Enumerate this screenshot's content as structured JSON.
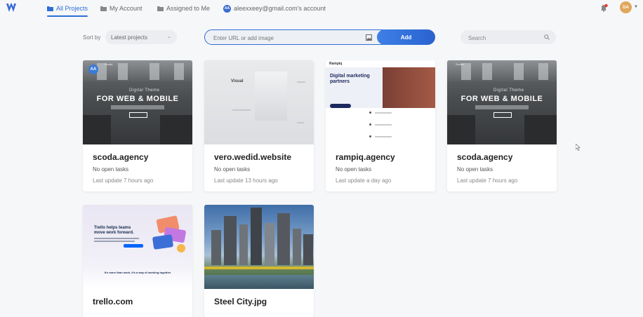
{
  "nav": {
    "tabs": [
      {
        "label": "All Projects",
        "icon": "folder-icon",
        "active": true
      },
      {
        "label": "My Account",
        "icon": "folder-icon",
        "active": false
      },
      {
        "label": "Assigned to Me",
        "icon": "folder-icon",
        "active": false
      },
      {
        "label": "aleexxeey@gmail.com's account",
        "icon": "account-badge",
        "badge": "AA",
        "active": false
      }
    ],
    "avatar_initials": "DA",
    "accent_color": "#2f6fd6"
  },
  "toolbar": {
    "sort_label": "Sort by",
    "sort_value": "Latest projects",
    "url_placeholder": "Enter URL or add image",
    "add_label": "Add",
    "search_placeholder": "Search"
  },
  "projects": [
    {
      "name": "scoda.agency",
      "tasks": "No open tasks",
      "updated": "Last update 7 hours ago",
      "thumb": {
        "badge": "AA",
        "brand": "Scoda",
        "small": "Digital Theme",
        "big": "FOR WEB & MOBILE"
      }
    },
    {
      "name": "vero.wedid.website",
      "tasks": "No open tasks",
      "updated": "Last update 13 hours ago",
      "thumb": {
        "label": "Visual"
      }
    },
    {
      "name": "rampiq.agency",
      "tasks": "No open tasks",
      "updated": "Last update a day ago",
      "thumb": {
        "logo": "Rampiq",
        "headline": "Digital marketing partners"
      }
    },
    {
      "name": "scoda.agency",
      "tasks": "No open tasks",
      "updated": "Last update 7 hours ago",
      "thumb": {
        "brand": "Scoda",
        "small": "Digital Theme",
        "big": "FOR WEB & MOBILE"
      }
    },
    {
      "name": "trello.com",
      "tasks": "",
      "updated": "",
      "thumb": {
        "headline": "Trello helps teams move work forward.",
        "middle": "It's more than work, it's a way of working together"
      }
    },
    {
      "name": "Steel City.jpg",
      "tasks": "",
      "updated": "",
      "thumb": {}
    }
  ]
}
